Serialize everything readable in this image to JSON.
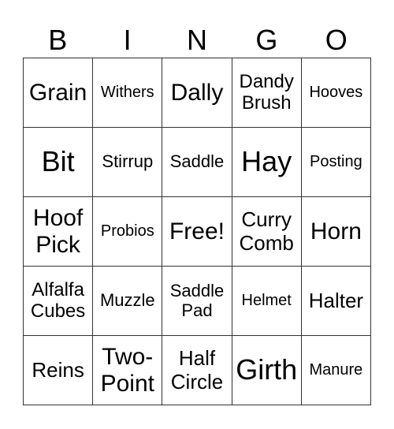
{
  "header": [
    "B",
    "I",
    "N",
    "G",
    "O"
  ],
  "cells": [
    [
      "Grain",
      "Withers",
      "Dally",
      "Dandy Brush",
      "Hooves"
    ],
    [
      "Bit",
      "Stirrup",
      "Saddle",
      "Hay",
      "Posting"
    ],
    [
      "Hoof Pick",
      "Probios",
      "Free!",
      "Curry Comb",
      "Horn"
    ],
    [
      "Alfalfa Cubes",
      "Muzzle",
      "Saddle Pad",
      "Helmet",
      "Halter"
    ],
    [
      "Reins",
      "Two-Point",
      "Half Circle",
      "Girth",
      "Manure"
    ]
  ]
}
